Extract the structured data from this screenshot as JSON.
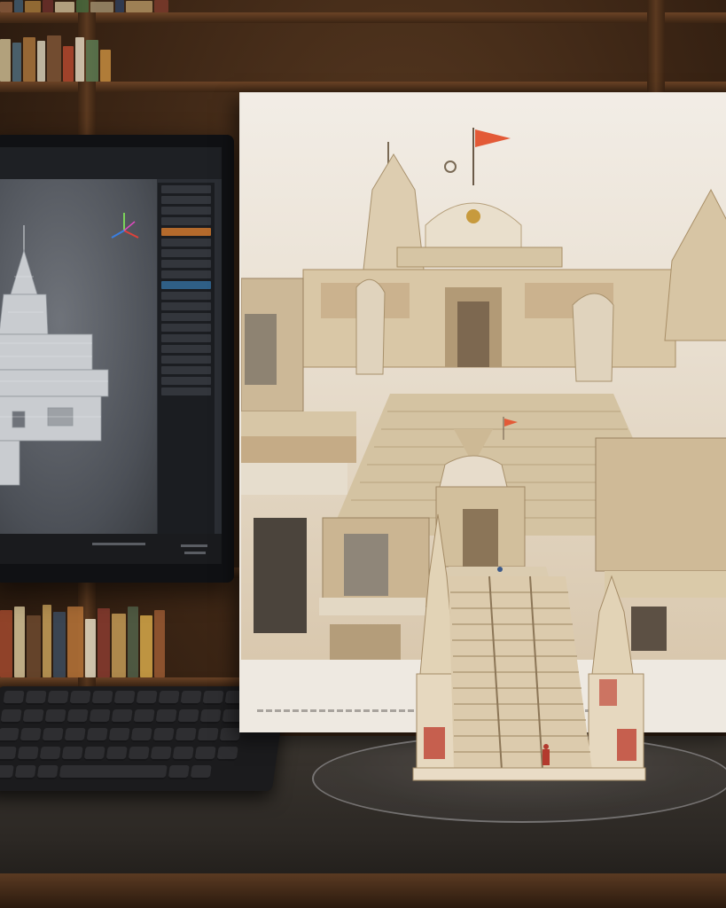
{
  "scene": {
    "description_items": [
      "bookshelf",
      "computer-monitor",
      "keyboard",
      "temple-print",
      "temple-model",
      "acrylic-base"
    ],
    "colors": {
      "wood": "#5c3a20",
      "stone": "#e4d6bd",
      "stone_shadow": "#b9a585",
      "flag": "#e35a37",
      "monitor_panel": "#1b1d21",
      "viewport_gray": "#6f737a"
    },
    "icons": [
      "axis-gizmo-icon"
    ]
  }
}
